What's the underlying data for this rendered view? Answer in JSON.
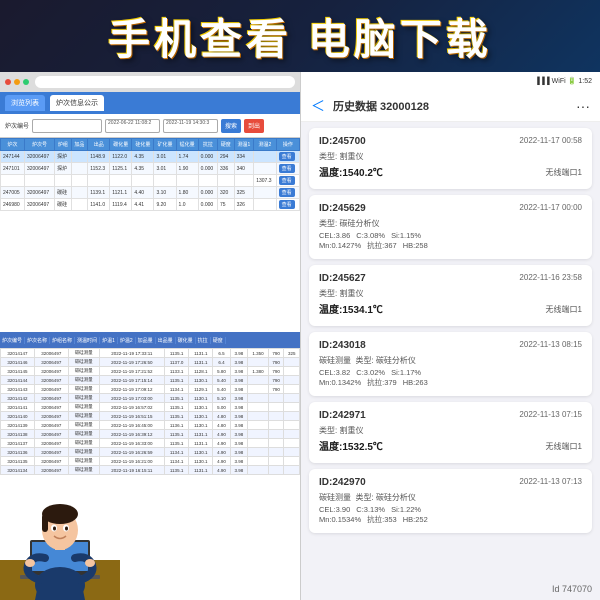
{
  "banner": {
    "text": "手机查看 电脑下载"
  },
  "left_panel": {
    "toolbar_tabs": [
      "浏览列表",
      "炉次信息公示"
    ],
    "active_tab": "炉次信息公示",
    "search": {
      "label": "炉次编号",
      "placeholder": "选择炉组",
      "date_from": "2022-06-22 11:08:2",
      "date_to": "2022-11-19 14:30:3",
      "search_btn": "搜索",
      "export_btn": "到出"
    },
    "table": {
      "headers": [
        "炉次",
        "炉次号",
        "炉组",
        "加品",
        "出品",
        "碳化量",
        "硅化量",
        "矿化量",
        "锰化量",
        "抗拉",
        "硬度",
        "测温1",
        "测温2",
        "操作"
      ],
      "rows": [
        [
          "247144",
          "32006497",
          "探炉",
          "",
          "1148.9",
          "1122.0",
          "4.35",
          "3.01",
          "1.74",
          "0.000",
          "294",
          "334",
          ""
        ],
        [
          "247101",
          "32006497",
          "探炉",
          "",
          "1152.3",
          "1125.1",
          "4.35",
          "3.01",
          "1.90",
          "0.000",
          "336",
          "340",
          ""
        ],
        [
          "",
          "",
          "",
          "",
          "",
          "",
          "",
          "",
          "",
          "",
          "",
          "",
          "1307.3",
          ""
        ],
        [
          "247005",
          "32006497",
          "碳硅",
          "",
          "1139.1",
          "1121.1",
          "4.40",
          "3.10",
          "1.80",
          "0.000",
          "320",
          "325",
          ""
        ],
        [
          "246980",
          "32006497",
          "碳硅",
          "",
          "1141.0",
          "1119.4",
          "4.41",
          "9.20",
          "1.0",
          "0.000",
          "75",
          "326",
          ""
        ]
      ]
    },
    "spreadsheet": {
      "headers": [
        "炉次编号",
        "炉次名称",
        "炉组名称",
        "测温时间",
        "炉温1",
        "炉温2",
        "炉次名",
        "加品量",
        "出品量",
        "碳化量",
        "硅化量",
        "矿化量",
        "锰化量",
        "抗拉",
        "硬度",
        "初始量",
        "测温量"
      ],
      "rows": [
        [
          "32014147",
          "32006497",
          "碳硅测量",
          "2022-11-19 17:33:11",
          "1135.1",
          "1131.1",
          "",
          "6.5",
          "3.98",
          "1.350",
          "",
          "790",
          "325"
        ],
        [
          "32014146",
          "32006497",
          "碳硅测量",
          "2022-11-19 17:26:50",
          "1137.0",
          "1131.1",
          "",
          "6.4",
          "3.98",
          "",
          "",
          "790",
          ""
        ],
        [
          "32014145",
          "32006497",
          "碳硅测量",
          "2022-11-19 17:21:52",
          "1133.1",
          "1128.1",
          "",
          "5.80",
          "3.98",
          "1.380",
          "",
          "790",
          ""
        ],
        [
          "32014144",
          "32006497",
          "碳硅测量",
          "2022-11-19 17:15:14",
          "1135.1",
          "1130.1",
          "",
          "5.40",
          "3.98",
          "",
          "",
          "790",
          ""
        ],
        [
          "32014143",
          "32006497",
          "碳硅测量",
          "2022-11-19 17:09:12",
          "1134.1",
          "1129.1",
          "",
          "5.40",
          "3.98",
          "",
          "",
          "790",
          ""
        ],
        [
          "32014142",
          "32006497",
          "碳硅测量",
          "2022-11-19 17:03:00",
          "1135.1",
          "1130.1",
          "",
          "5.10",
          "3.98",
          "",
          "",
          "",
          ""
        ],
        [
          "32014141",
          "32006497",
          "碳硅测量",
          "2022-11-19 16:57:02",
          "1135.1",
          "1130.1",
          "",
          "5.00",
          "3.98",
          "",
          "",
          "",
          ""
        ],
        [
          "32014140",
          "32006497",
          "碳硅测量",
          "2022-11-19 16:51:15",
          "1135.1",
          "1130.1",
          "",
          "4.80",
          "3.98",
          "",
          "",
          "",
          ""
        ],
        [
          "32014139",
          "32006497",
          "碳硅测量",
          "2022-11-19 16:45:00",
          "1136.1",
          "1130.1",
          "",
          "4.80",
          "3.98",
          "",
          "",
          "",
          ""
        ],
        [
          "32014138",
          "32006497",
          "碳硅测量",
          "2022-11-19 16:39:12",
          "1135.1",
          "1131.1",
          "",
          "4.90",
          "3.98",
          "",
          "",
          "",
          ""
        ],
        [
          "32014137",
          "32006497",
          "碳硅测量",
          "2022-11-19 16:33:00",
          "1135.1",
          "1131.1",
          "",
          "4.90",
          "3.98",
          "",
          "",
          "",
          ""
        ],
        [
          "32014136",
          "32006497",
          "碳硅测量",
          "2022-11-19 16:26:59",
          "1134.1",
          "1130.1",
          "",
          "4.90",
          "3.98",
          "",
          "",
          "",
          ""
        ],
        [
          "32014135",
          "32006497",
          "碳硅测量",
          "2022-11-19 16:21:00",
          "1134.1",
          "1130.1",
          "",
          "4.90",
          "3.98",
          "",
          "",
          "",
          ""
        ],
        [
          "32014134",
          "32006497",
          "碳硅测量",
          "2022-11-19 16:15:11",
          "1135.1",
          "1131.1",
          "",
          "4.90",
          "3.98",
          "",
          "",
          "",
          ""
        ]
      ]
    }
  },
  "right_panel": {
    "title": "历史数据 32000128",
    "back_label": "＜",
    "status_time": "1:52",
    "records": [
      {
        "id": "ID:245700",
        "date": "2022-11-17 00:58",
        "type": "类型: 割重仪",
        "temperature": "温度:1540.2℃",
        "right_info": "无线端口1"
      },
      {
        "id": "ID:245629",
        "date": "2022-11-17 00:00",
        "type": "类型: 碳硅分析仪",
        "cel": "CEL:3.86",
        "c": "C:3.08%",
        "si": "Si:1.15%",
        "mn": "Mn:0.1427%",
        "kangla": "抗拉:367",
        "hb": "HB:258"
      },
      {
        "id": "ID:245627",
        "date": "2022-11-16 23:58",
        "type": "类型: 割重仪",
        "temperature": "温度:1534.1℃",
        "right_info": "无线端口1"
      },
      {
        "id": "ID:243018",
        "date": "2022-11-13 08:15",
        "type": "类型: 碳硅分析仪",
        "cel": "CEL:3.82",
        "c": "C:3.02%",
        "si": "Si:1.17%",
        "mn": "Mn:0.1342%",
        "kangla": "抗拉:379",
        "hb": "HB:263"
      },
      {
        "id": "ID:242971",
        "date": "2022-11-13 07:15",
        "type": "类型: 割重仪",
        "temperature": "温度:1532.5℃",
        "right_info": "无线端口1"
      },
      {
        "id": "ID:242970",
        "date": "2022-11-13 07:13",
        "type": "类型: 碳硅分析仪",
        "cel": "CEL:3.90",
        "c": "C:3.13%",
        "si": "Si:1.22%",
        "mn": "Mn:0.1534%",
        "kangla": "抗拉:353",
        "hb": "HB:252"
      }
    ],
    "id_badge": "Id 747070"
  }
}
